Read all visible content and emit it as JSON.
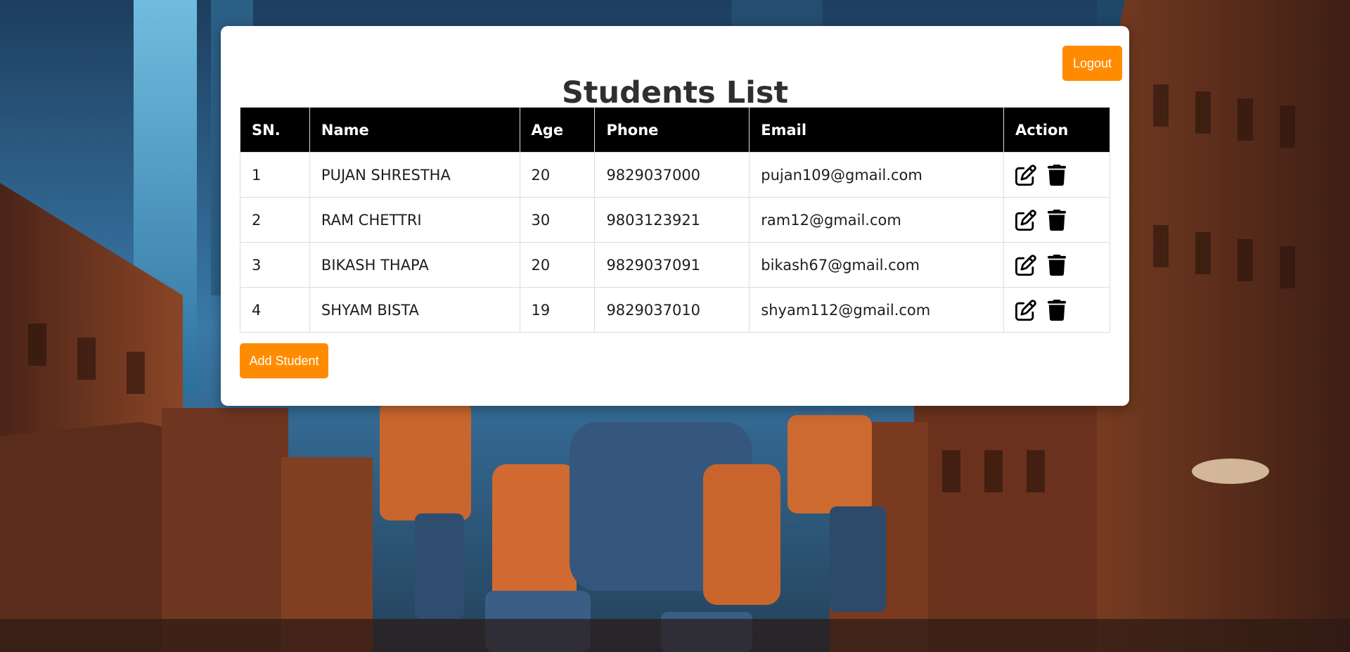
{
  "header": {
    "title": "Students List",
    "logout_label": "Logout"
  },
  "table": {
    "columns": [
      "SN.",
      "Name",
      "Age",
      "Phone",
      "Email",
      "Action"
    ],
    "rows": [
      {
        "sn": "1",
        "name": "PUJAN SHRESTHA",
        "age": "20",
        "phone": "9829037000",
        "email": "pujan109@gmail.com"
      },
      {
        "sn": "2",
        "name": "RAM CHETTRI",
        "age": "30",
        "phone": "9803123921",
        "email": "ram12@gmail.com"
      },
      {
        "sn": "3",
        "name": "BIKASH THAPA",
        "age": "20",
        "phone": "9829037091",
        "email": "bikash67@gmail.com"
      },
      {
        "sn": "4",
        "name": "SHYAM BISTA",
        "age": "19",
        "phone": "9829037010",
        "email": "shyam112@gmail.com"
      }
    ],
    "row_actions": [
      "edit-icon",
      "trash-icon"
    ]
  },
  "footer": {
    "add_label": "Add Student"
  },
  "colors": {
    "accent": "#ff8c00",
    "header_bg": "#000000",
    "card_bg": "#ffffff"
  }
}
